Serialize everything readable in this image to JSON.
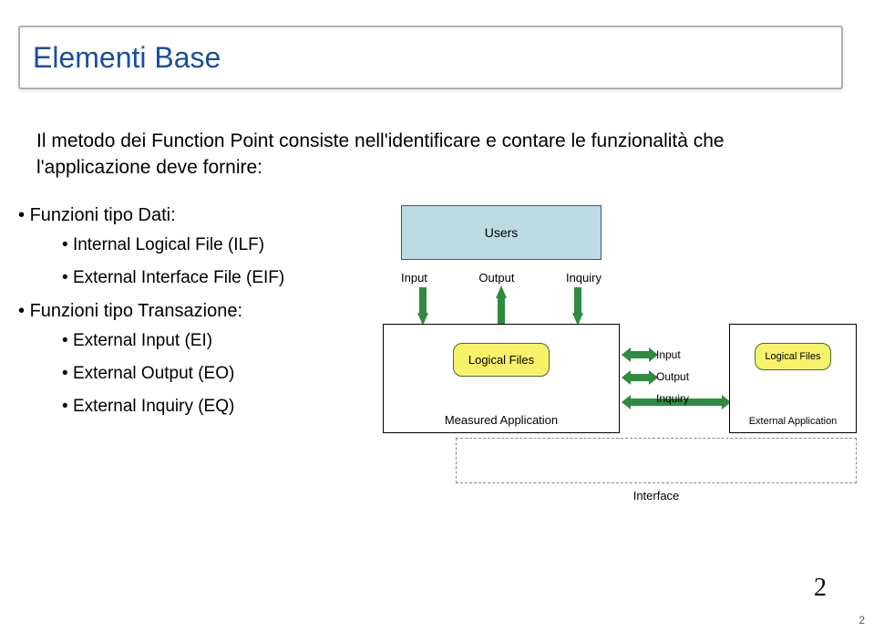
{
  "title": "Elementi Base",
  "intro": "Il metodo dei Function Point consiste nell'identificare e contare le funzionalità che l'applicazione deve fornire:",
  "bullets": {
    "g1": "Funzioni tipo Dati:",
    "g1_items": [
      "Internal Logical File (ILF)",
      "External Interface File (EIF)"
    ],
    "g2": "Funzioni tipo Transazione:",
    "g2_items": [
      "External Input (EI)",
      "External Output (EO)",
      "External Inquiry (EQ)"
    ]
  },
  "diagram": {
    "users": "Users",
    "input": "Input",
    "output": "Output",
    "inquiry": "Inquiry",
    "logical_files": "Logical Files",
    "measured_app": "Measured Application",
    "external_app": "External Application",
    "interface": "Interface"
  },
  "page_number": "2",
  "corner_number": "2"
}
